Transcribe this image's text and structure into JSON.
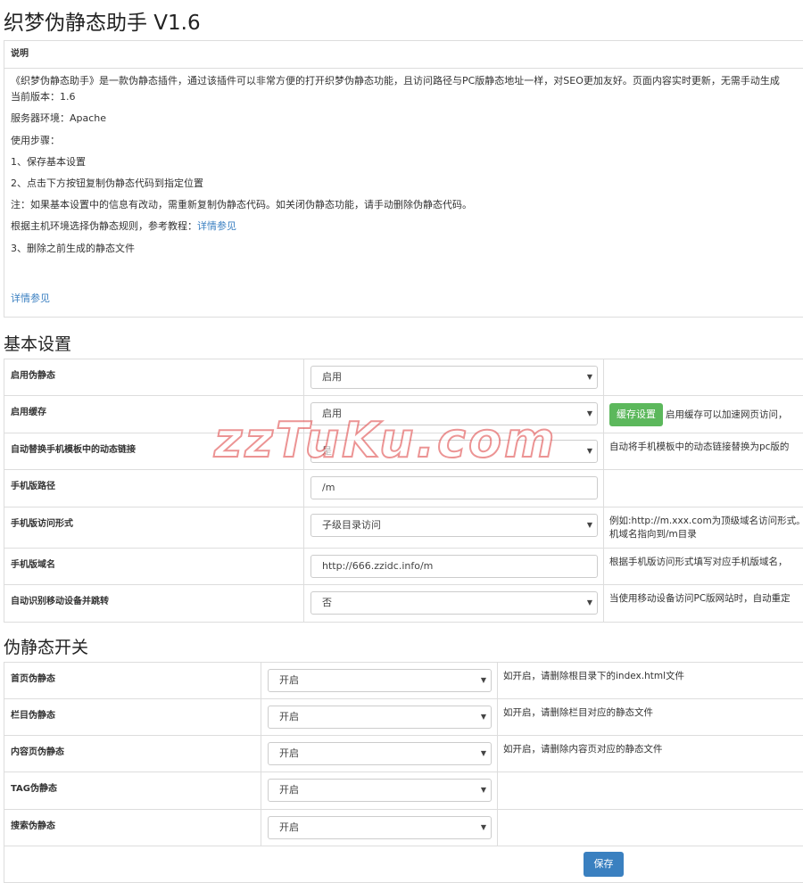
{
  "title": "织梦伪静态助手 V1.6",
  "description": {
    "header": "说明",
    "lines": [
      "《织梦伪静态助手》是一款伪静态插件，通过该插件可以非常方便的打开织梦伪静态功能，且访问路径与PC版静态地址一样，对SEO更加友好。页面内容实时更新，无需手动生成",
      "当前版本：1.6",
      "服务器环境：Apache",
      "使用步骤：",
      "1、保存基本设置",
      "2、点击下方按钮复制伪静态代码到指定位置",
      "注：如果基本设置中的信息有改动，需重新复制伪静态代码。如关闭伪静态功能，请手动删除伪静态代码。",
      "根据主机环境选择伪静态规则，参考教程：",
      "3、删除之前生成的静态文件"
    ],
    "tutorial_link": "详情参见",
    "more_link": "详情参见"
  },
  "basic": {
    "heading": "基本设置",
    "rows": [
      {
        "label": "启用伪静态",
        "value": "启用",
        "hint": ""
      },
      {
        "label": "启用缓存",
        "value": "启用",
        "button": "缓存设置",
        "hint": "启用缓存可以加速网页访问，"
      },
      {
        "label": "自动替换手机模板中的动态链接",
        "value": "是",
        "hint": "自动将手机模板中的动态链接替换为pc版的"
      },
      {
        "label": "手机版路径",
        "input": "/m",
        "hint": ""
      },
      {
        "label": "手机版访问形式",
        "value": "子级目录访问",
        "hint": "例如:http://m.xxx.com为顶级域名访问形式。",
        "hint2": "机域名指向到/m目录"
      },
      {
        "label": "手机版域名",
        "input": "http://666.zzidc.info/m",
        "hint": "根据手机版访问形式填写对应手机版域名，"
      },
      {
        "label": "自动识别移动设备并跳转",
        "value": "否",
        "hint": "当使用移动设备访问PC版网站时，自动重定"
      }
    ]
  },
  "rewrite": {
    "heading": "伪静态开关",
    "rows": [
      {
        "label": "首页伪静态",
        "value": "开启",
        "hint": "如开启，请删除根目录下的index.html文件"
      },
      {
        "label": "栏目伪静态",
        "value": "开启",
        "hint": "如开启，请删除栏目对应的静态文件"
      },
      {
        "label": "内容页伪静态",
        "value": "开启",
        "hint": "如开启，请删除内容页对应的静态文件"
      },
      {
        "label": "TAG伪静态",
        "value": "开启",
        "hint": ""
      },
      {
        "label": "搜索伪静态",
        "value": "开启",
        "hint": ""
      }
    ]
  },
  "save_label": "保存",
  "watermark": "zzTuKu.com",
  "colors": {
    "link": "#3a7fc1",
    "green_button": "#5cb85c",
    "blue_button": "#3a80c0"
  }
}
